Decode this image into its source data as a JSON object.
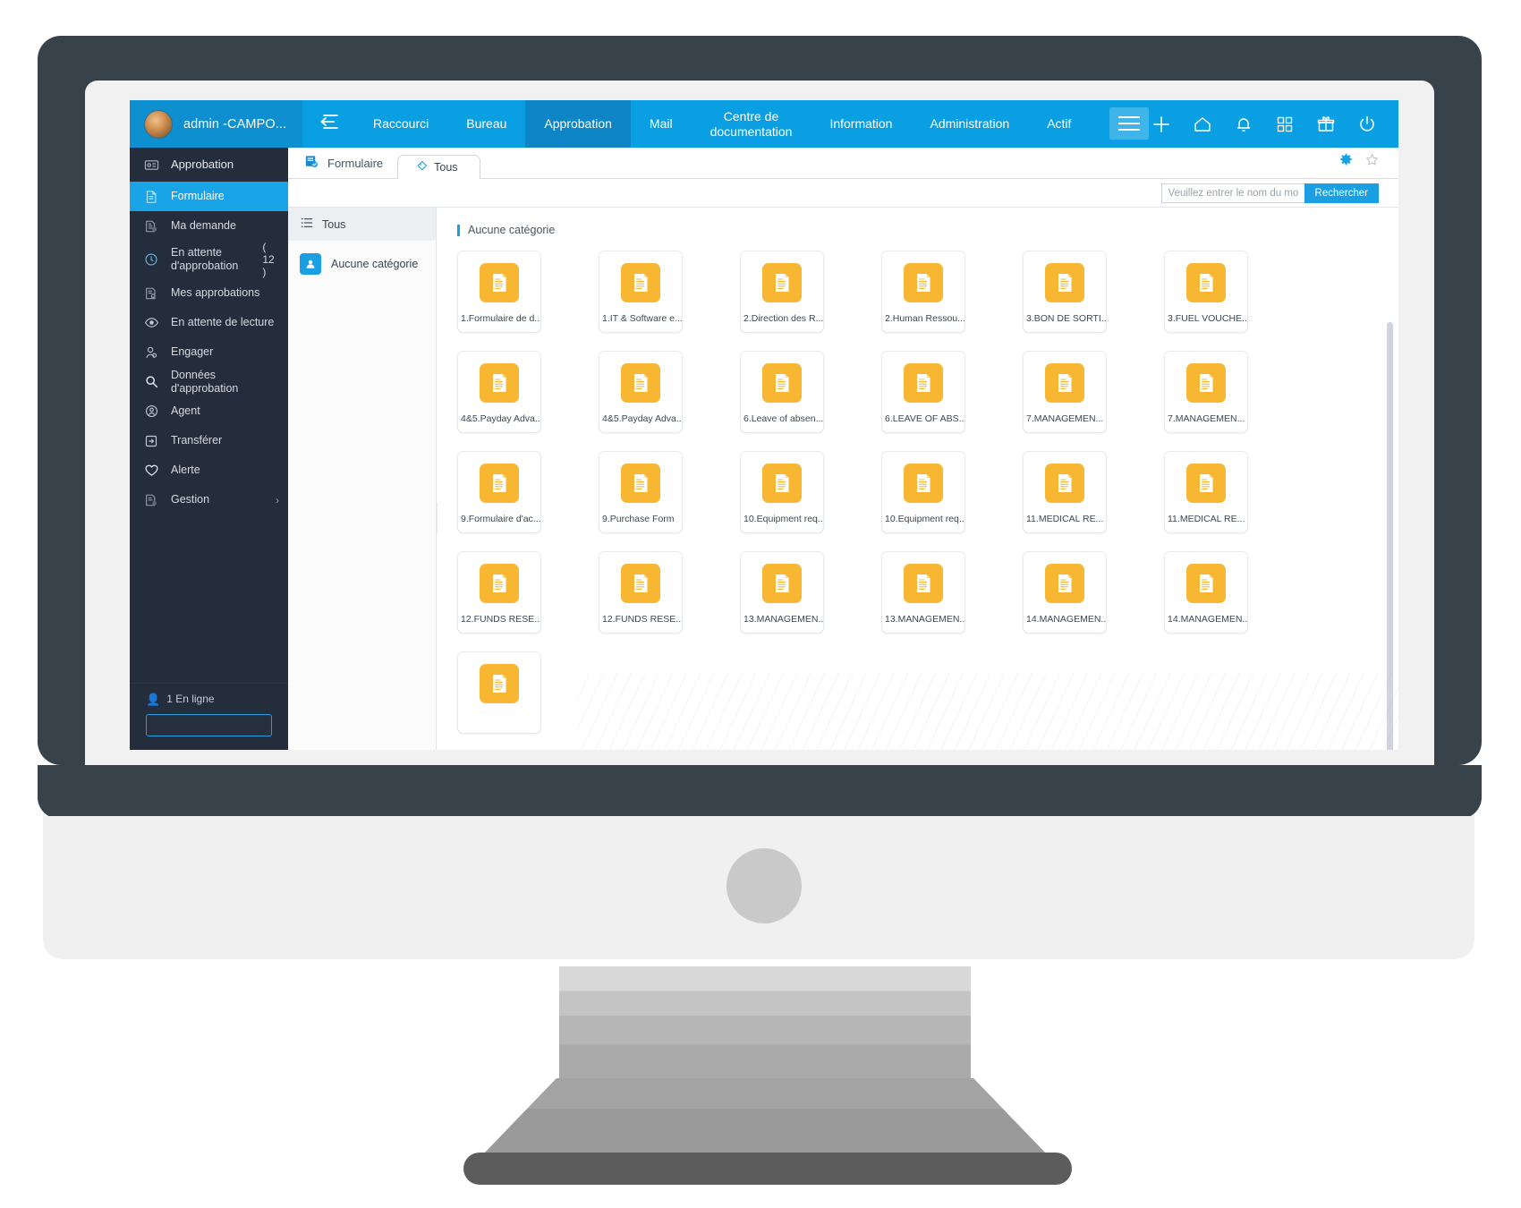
{
  "topnav": {
    "user_name": "admin -CAMPO...",
    "menu_toggle_icon": "list-collapse-icon",
    "items": [
      {
        "label": "Raccourci",
        "active": false
      },
      {
        "label": "Bureau",
        "active": false
      },
      {
        "label": "Approbation",
        "active": true
      },
      {
        "label": "Mail",
        "active": false
      },
      {
        "label": "Centre de\ndocumentation",
        "active": false
      },
      {
        "label": "Information",
        "active": false
      },
      {
        "label": "Administration",
        "active": false
      },
      {
        "label": "Actif",
        "active": false
      }
    ],
    "right_icons": [
      "plus-icon",
      "home-icon",
      "bell-icon",
      "apps-grid-icon",
      "gift-icon",
      "power-icon"
    ],
    "accent_color": "#0a9fe2",
    "accent_active_color": "#0e86c6"
  },
  "sidebar": {
    "header": {
      "label": "Approbation",
      "icon": "approval-card-icon"
    },
    "items": [
      {
        "label": "Formulaire",
        "icon": "form-icon",
        "active": true,
        "count": ""
      },
      {
        "label": "Ma demande",
        "icon": "request-icon",
        "active": false,
        "count": ""
      },
      {
        "label": "En attente d'approbation",
        "icon": "pending-approval-icon",
        "active": false,
        "count": "( 12 )"
      },
      {
        "label": "Mes approbations",
        "icon": "my-approvals-icon",
        "active": false,
        "count": ""
      },
      {
        "label": "En attente de lecture",
        "icon": "eye-icon",
        "active": false,
        "count": ""
      },
      {
        "label": "Engager",
        "icon": "person-search-icon",
        "active": false,
        "count": ""
      },
      {
        "label": "Données d'approbation",
        "icon": "magnifier-icon",
        "active": false,
        "count": ""
      },
      {
        "label": "Agent",
        "icon": "agent-icon",
        "active": false,
        "count": ""
      },
      {
        "label": "Transférer",
        "icon": "transfer-icon",
        "active": false,
        "count": ""
      },
      {
        "label": "Alerte",
        "icon": "heart-icon",
        "active": false,
        "count": ""
      },
      {
        "label": "Gestion",
        "icon": "management-icon",
        "active": false,
        "count": "",
        "caret": "›"
      }
    ],
    "online_status": "1 En ligne",
    "search_placeholder": "",
    "search_value": "",
    "bg_color": "#232d3b",
    "active_color": "#1aa4e8"
  },
  "tabstrip": {
    "breadcrumb": "Formulaire",
    "breadcrumb_icon": "form-doc-icon",
    "tab": {
      "label": "Tous",
      "icon": "tag-icon"
    },
    "gear_icon": "gear-icon",
    "star_icon": "star-icon"
  },
  "search": {
    "placeholder": "Veuillez entrer le nom du modèle",
    "value": "",
    "button_label": "Rechercher"
  },
  "categories": {
    "all_label": "Tous",
    "all_icon": "list-icon",
    "items": [
      {
        "label": "Aucune catégorie",
        "icon": "user-badge-icon"
      }
    ]
  },
  "content": {
    "section_title": "Aucune catégorie",
    "collapse_handle": "‹",
    "tiles": [
      {
        "label": "1.Formulaire de d...",
        "icon": "document-icon"
      },
      {
        "label": "1.IT & Software e...",
        "icon": "document-icon"
      },
      {
        "label": "2.Direction des R...",
        "icon": "document-icon"
      },
      {
        "label": "2.Human Ressou...",
        "icon": "document-icon"
      },
      {
        "label": "3.BON DE SORTI...",
        "icon": "document-icon"
      },
      {
        "label": "3.FUEL VOUCHE...",
        "icon": "document-icon"
      },
      {
        "label": "4&5.Payday Adva...",
        "icon": "document-icon"
      },
      {
        "label": "4&5.Payday Adva...",
        "icon": "document-icon"
      },
      {
        "label": "6.Leave of absen...",
        "icon": "document-icon"
      },
      {
        "label": "6.LEAVE OF ABS...",
        "icon": "document-icon"
      },
      {
        "label": "7.MANAGEMEN...",
        "icon": "document-icon"
      },
      {
        "label": "7.MANAGEMEN...",
        "icon": "document-icon"
      },
      {
        "label": "9.Formulaire d'ac...",
        "icon": "document-icon"
      },
      {
        "label": "9.Purchase Form",
        "icon": "document-icon"
      },
      {
        "label": "10.Equipment req...",
        "icon": "document-icon"
      },
      {
        "label": "10.Equipment req...",
        "icon": "document-icon"
      },
      {
        "label": "11.MEDICAL RE...",
        "icon": "document-icon"
      },
      {
        "label": "11.MEDICAL RE...",
        "icon": "document-icon"
      },
      {
        "label": "12.FUNDS RESE...",
        "icon": "document-icon"
      },
      {
        "label": "12.FUNDS RESE...",
        "icon": "document-icon"
      },
      {
        "label": "13.MANAGEMEN...",
        "icon": "document-icon"
      },
      {
        "label": "13.MANAGEMEN...",
        "icon": "document-icon"
      },
      {
        "label": "14.MANAGEMEN...",
        "icon": "document-icon"
      },
      {
        "label": "14.MANAGEMEN...",
        "icon": "document-icon"
      },
      {
        "label": "",
        "icon": "document-icon"
      }
    ],
    "tile_icon_color": "#f7b733"
  }
}
